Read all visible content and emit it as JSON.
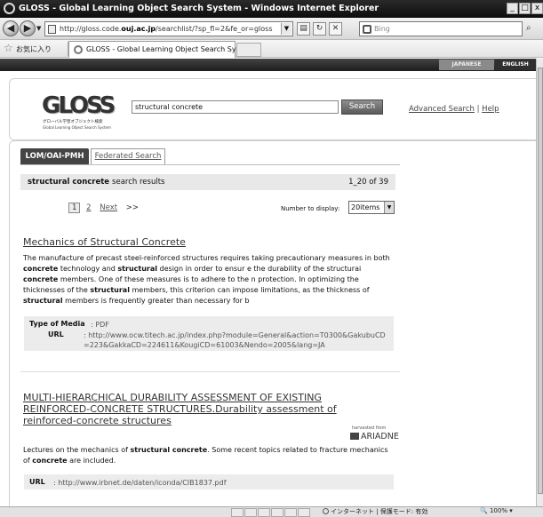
{
  "window": {
    "title": "GLOSS - Global Learning Object Search System - Windows Internet Explorer",
    "min": "_",
    "max": "□",
    "close": "x"
  },
  "address": {
    "url_prefix": "http://gloss.code.",
    "url_domain": "ouj.ac.jp",
    "url_suffix": "/searchlist/?sp_fl=2&fe_or=gloss&tmp=%2Fsearchlist",
    "search_placeholder": "Bing"
  },
  "favorites": {
    "label": "お気に入り",
    "tab_title": "GLOSS - Global Learning Object Search System"
  },
  "lang": {
    "japanese": "JAPANESE",
    "english": "ENGLISH"
  },
  "logo": {
    "text": "GLOSS",
    "subtitle_jp": "グローバル学習オブジェクト検索",
    "subtitle_en": "Global Learning Object Search System"
  },
  "search": {
    "query": "structural concrete",
    "button": "Search",
    "advanced": "Advanced Search",
    "separator": "|",
    "help": "Help"
  },
  "tabs": {
    "lom": "LOM/OAI-PMH",
    "federated": "Federated Search"
  },
  "results": {
    "query": "structural concrete",
    "suffix": "search results",
    "range": "1_20 of 39",
    "pages": [
      "1",
      "2"
    ],
    "next": "Next",
    "next_arrows": ">>",
    "display_label": "Number to display:",
    "display_value": "20items"
  },
  "result1": {
    "title": "Mechanics of Structural Concrete",
    "desc": [
      {
        "t": "The manufacture of precast steel-reinforced structures requires taking precautionary measures in both "
      },
      {
        "b": "concrete"
      },
      {
        "t": " technology and "
      },
      {
        "b": "structural"
      },
      {
        "t": " design in order to ensur e the durability of the structurai "
      },
      {
        "b": "concrete"
      },
      {
        "t": " members. One of these measures is to adhere to the n protection. In optimizing the thicknesses of the "
      },
      {
        "b": "structural"
      },
      {
        "t": " members, this criterion can impose limitations, as the thickness of "
      },
      {
        "b": "structural"
      },
      {
        "t": " members is frequently greater than necessary for b"
      }
    ],
    "type_label": "Type of Media",
    "type_value": ": PDF",
    "url_label": "URL",
    "url_value": ": http://www.ocw.titech.ac.jp/index.php?module=General&action=T0300&GakubuCD=223&GakkaCD=224611&KougiCD=61003&Nendo=2005&lang=JA"
  },
  "result2": {
    "title": "MULTI-HIERARCHICAL DURABILITY ASSESSMENT OF EXISTING REINFORCED-CONCRETE STRUCTURES.Durability assessment of reinforced-concrete structures",
    "harvested": "harvested from",
    "source": "ARIADNE",
    "desc": [
      {
        "t": "Lectures on the mechanics of "
      },
      {
        "b": "structural concrete"
      },
      {
        "t": ". Some recent topics related to fracture mechanics of "
      },
      {
        "b": "concrete"
      },
      {
        "t": " are included."
      }
    ],
    "url_label": "URL",
    "url_value": ": http://www.irbnet.de/daten/iconda/CIB1837.pdf"
  },
  "status": {
    "zone": "インターネット | 保護モード: 有効",
    "zoom": "100%"
  }
}
